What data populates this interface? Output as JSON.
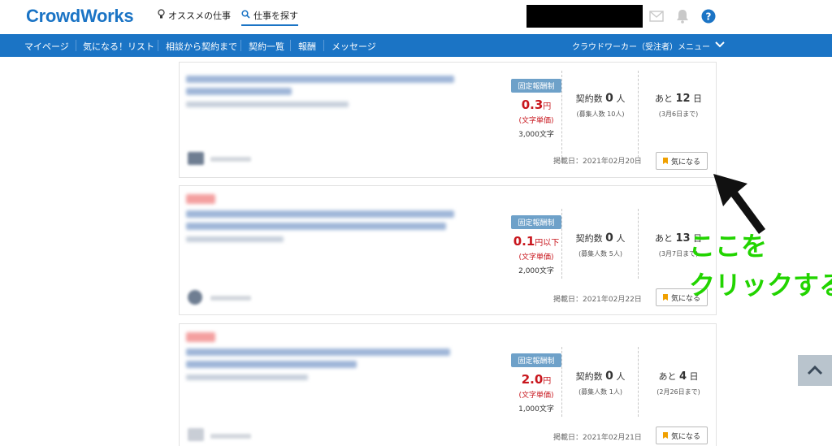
{
  "header": {
    "logo": "CrowdWorks",
    "recommended_label": "オススメの仕事",
    "search_label": "仕事を探す"
  },
  "nav": {
    "items": [
      {
        "label": "マイページ"
      },
      {
        "label": "気になる！リスト"
      },
      {
        "label": "相談から契約まで"
      },
      {
        "label": "契約一覧"
      },
      {
        "label": "報酬"
      },
      {
        "label": "メッセージ"
      }
    ],
    "right_menu": "クラウドワーカー（受注者）メニュー"
  },
  "jobs": [
    {
      "badge": "固定報酬制",
      "price_num": "0.3",
      "price_unit": "円",
      "price_note": "(文字単価)",
      "chars": "3,000文字",
      "contract_label": "契約数",
      "contract_num": "0",
      "contract_unit": "人",
      "recruit": "(募集人数 10人)",
      "deadline_prefix": "あと",
      "deadline_num": "12",
      "deadline_unit": "日",
      "deadline_date": "(3月6日まで)",
      "posted": "掲載日：2021年02月20日",
      "fav_label": "気になる"
    },
    {
      "badge": "固定報酬制",
      "price_num": "0.1",
      "price_unit": "円以下",
      "price_note": "(文字単価)",
      "chars": "2,000文字",
      "contract_label": "契約数",
      "contract_num": "0",
      "contract_unit": "人",
      "recruit": "(募集人数 5人)",
      "deadline_prefix": "あと",
      "deadline_num": "13",
      "deadline_unit": "日",
      "deadline_date": "(3月7日まで)",
      "posted": "掲載日：2021年02月22日",
      "fav_label": "気になる"
    },
    {
      "badge": "固定報酬制",
      "price_num": "2.0",
      "price_unit": "円",
      "price_note": "(文字単価)",
      "chars": "1,000文字",
      "contract_label": "契約数",
      "contract_num": "0",
      "contract_unit": "人",
      "recruit": "(募集人数 1人)",
      "deadline_prefix": "あと",
      "deadline_num": "4",
      "deadline_unit": "日",
      "deadline_date": "(2月26日まで)",
      "posted": "掲載日：2021年02月21日",
      "fav_label": "気になる"
    }
  ],
  "annotation": {
    "line1": "ここを",
    "line2": "クリックする",
    "color": "#22d400"
  },
  "colors": {
    "brand": "#1b74c5",
    "price": "#c8161d",
    "badge": "#6ea1c9",
    "fav_flag": "#f0a000"
  },
  "icons": [
    "lightbulb-icon",
    "search-icon",
    "mail-icon",
    "bell-icon",
    "help-icon",
    "chevron-down-icon",
    "bookmark-icon",
    "chevron-up-icon"
  ]
}
